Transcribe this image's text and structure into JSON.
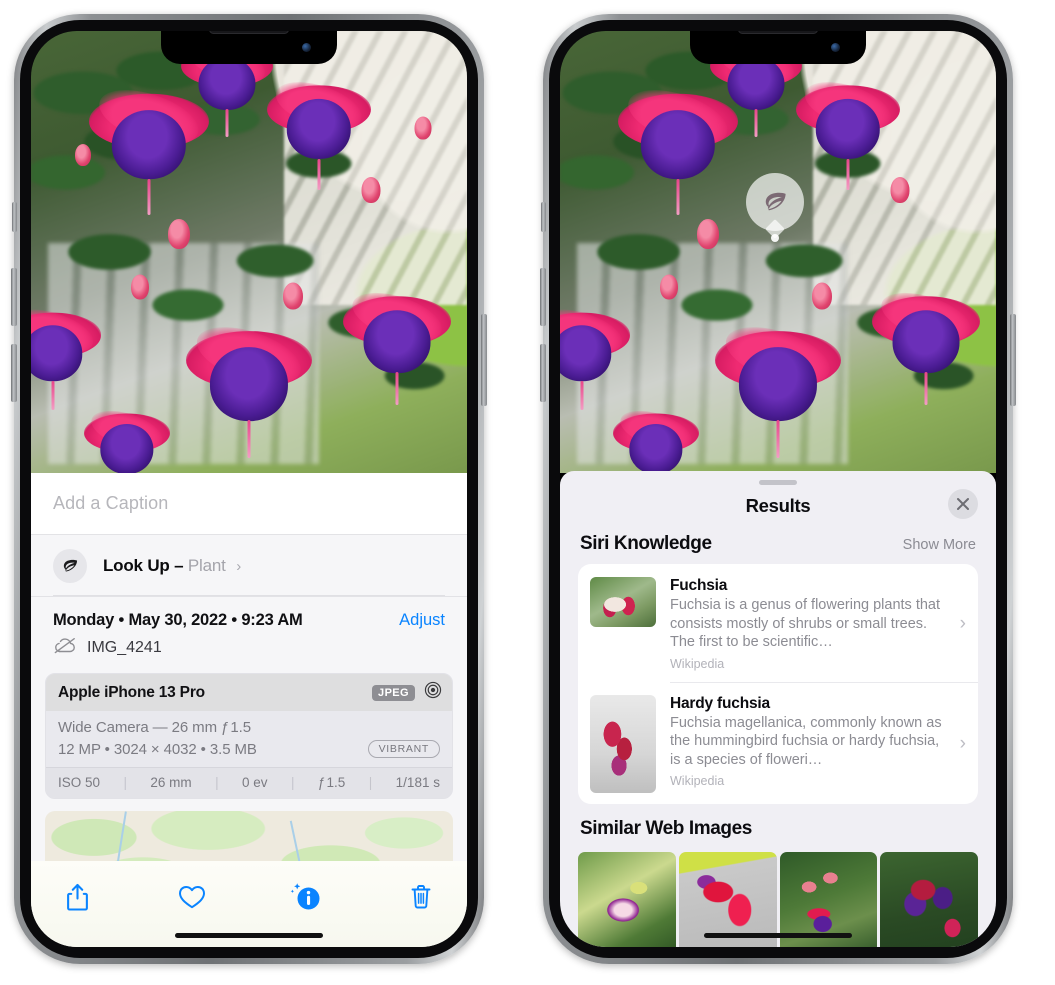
{
  "left_phone": {
    "caption": {
      "placeholder": "Add a Caption",
      "value": ""
    },
    "lookup": {
      "label": "Look Up",
      "dash": "–",
      "subject": "Plant",
      "chevron": "›",
      "icon": "leaf-icon"
    },
    "meta": {
      "datetime": "Monday • May 30, 2022 • 9:23 AM",
      "adjust_label": "Adjust",
      "filename": "IMG_4241",
      "cloud_icon": "icloud-slash-icon"
    },
    "camera_card": {
      "model": "Apple iPhone 13 Pro",
      "format_badge": "JPEG",
      "raw_icon": "aperture-icon",
      "lens_line": "Wide Camera — 26 mm ƒ 1.5",
      "detail_line": "12 MP • 3024 × 4032 • 3.5 MB",
      "style_badge": "VIBRANT",
      "exif": [
        "ISO 50",
        "26 mm",
        "0 ev",
        "ƒ 1.5",
        "1/181 s"
      ]
    },
    "map": {
      "name": "photo-location-map",
      "pin": "photo-pin-thumbnail"
    },
    "toolbar": [
      {
        "name": "share-button",
        "icon": "share-icon"
      },
      {
        "name": "favorite-button",
        "icon": "heart-icon"
      },
      {
        "name": "info-button",
        "icon": "info-sparkle-icon"
      },
      {
        "name": "delete-button",
        "icon": "trash-icon"
      }
    ]
  },
  "right_phone": {
    "badge": {
      "name": "visual-lookup-badge",
      "icon": "leaf-icon"
    },
    "sheet": {
      "title": "Results",
      "close_label": "✕",
      "grabber": "sheet-grabber"
    },
    "siri_knowledge": {
      "title": "Siri Knowledge",
      "show_more": "Show More",
      "items": [
        {
          "title": "Fuchsia",
          "description": "Fuchsia is a genus of flowering plants that consists mostly of shrubs or small trees. The first to be scientific…",
          "source": "Wikipedia",
          "chevron": "›"
        },
        {
          "title": "Hardy fuchsia",
          "description": "Fuchsia magellanica, commonly known as the hummingbird fuchsia or hardy fuchsia, is a species of floweri…",
          "source": "Wikipedia",
          "chevron": "›"
        }
      ]
    },
    "similar_web_images": {
      "title": "Similar Web Images",
      "tiles": [
        {
          "name": "web-image-1"
        },
        {
          "name": "web-image-2"
        },
        {
          "name": "web-image-3"
        },
        {
          "name": "web-image-4"
        }
      ]
    }
  },
  "colors": {
    "accent_blue": "#0a84ff",
    "sheet_bg": "#f0eff4",
    "panel_bg": "#f6f6f8",
    "card_bg": "#e9e9ee",
    "secondary_text": "#8c8c93"
  }
}
